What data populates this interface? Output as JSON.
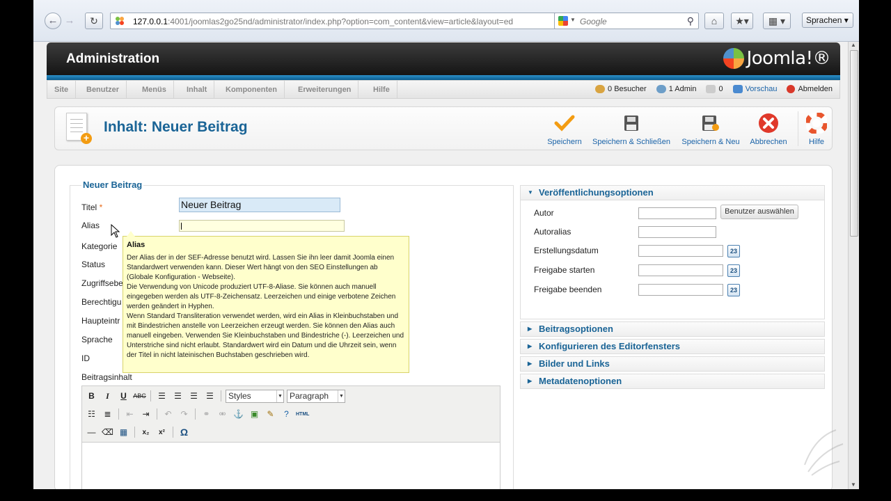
{
  "browser": {
    "url_host": "127.0.0.1",
    "url_rest": ":4001/joomlas2go25nd/administrator/index.php?option=com_content&view=article&layout=ed",
    "search_placeholder": "Google",
    "sprachen_label": "Sprachen ▾"
  },
  "admin": {
    "title": "Administration",
    "logo_text": "Joomla!®"
  },
  "menu": {
    "items": [
      "Site",
      "Benutzer",
      "Menüs",
      "Inhalt",
      "Komponenten",
      "Erweiterungen",
      "Hilfe"
    ],
    "status": {
      "visitors": "0 Besucher",
      "admins": "1 Admin",
      "messages": "0",
      "preview": "Vorschau",
      "logout": "Abmelden"
    }
  },
  "page": {
    "title": "Inhalt: Neuer Beitrag",
    "toolbar": {
      "save": "Speichern",
      "save_close": "Speichern & Schließen",
      "save_new": "Speichern & Neu",
      "cancel": "Abbrechen",
      "help": "Hilfe"
    }
  },
  "form": {
    "legend": "Neuer Beitrag",
    "labels": {
      "title": "Titel",
      "required": "*",
      "alias": "Alias",
      "category": "Kategorie",
      "status": "Status",
      "access": "Zugriffsebe",
      "permissions": "Berechtigu",
      "featured": "Haupteintr",
      "language": "Sprache",
      "id": "ID",
      "content": "Beitragsinhalt"
    },
    "title_value": "Neuer Beitrag"
  },
  "editor": {
    "styles_select": "Styles",
    "format_select": "Paragraph"
  },
  "tooltip": {
    "title": "Alias",
    "text": "Der Alias der in der SEF-Adresse benutzt wird. Lassen Sie ihn leer damit Joomla einen Standardwert verwenden kann. Dieser Wert hängt von den SEO Einstellungen ab (Globale Konfiguration - Webseite).\nDie Verwendung von Unicode produziert UTF-8-Aliase. Sie können auch manuell eingegeben werden als UTF-8-Zeichensatz. Leerzeichen und einige verbotene Zeichen werden geändert in Hyphen.\nWenn Standard Transliteration verwendet werden, wird ein Alias in Kleinbuchstaben und mit Bindestrichen anstelle von Leerzeichen erzeugt werden. Sie können den Alias auch manuell eingeben. Verwenden Sie Kleinbuchstaben und Bindestriche (-). Leerzeichen und Unterstriche sind nicht erlaubt. Standardwert wird ein Datum und die Uhrzeit sein, wenn der Titel in nicht lateinischen Buchstaben geschrieben wird."
  },
  "publishing": {
    "header": "Veröffentlichungsoptionen",
    "author": "Autor",
    "select_user": "Benutzer auswählen",
    "author_alias": "Autoralias",
    "created_date": "Erstellungsdatum",
    "publish_up": "Freigabe starten",
    "publish_down": "Freigabe beenden",
    "cal_label": "23"
  },
  "panels": {
    "article_options": "Beitragsoptionen",
    "editor_config": "Konfigurieren des Editorfensters",
    "images_links": "Bilder und Links",
    "metadata": "Metadatenoptionen"
  },
  "colors": {
    "link_blue": "#1a63a8",
    "heading_blue": "#1a6496",
    "tooltip_bg": "#ffffcc",
    "cancel_red": "#e0392b",
    "save_orange": "#f39c12"
  }
}
